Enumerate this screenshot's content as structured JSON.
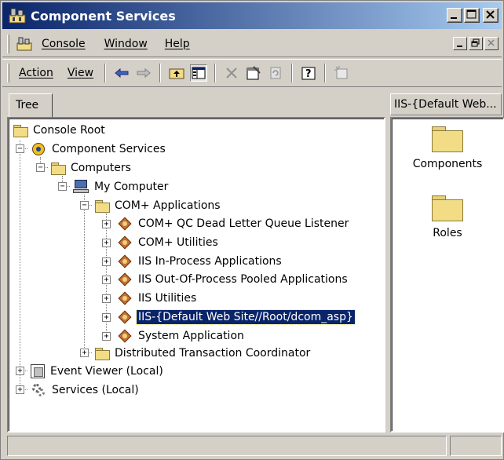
{
  "window": {
    "title": "Component Services"
  },
  "menubar": {
    "items": [
      "Console",
      "Window",
      "Help"
    ]
  },
  "toolbar": {
    "action_label": "Action",
    "view_label": "View"
  },
  "tabs": {
    "tree_label": "Tree",
    "right_header": "IIS-{Default Web..."
  },
  "tree": {
    "console_root": "Console Root",
    "component_services": "Component Services",
    "computers": "Computers",
    "my_computer": "My Computer",
    "com_apps": "COM+ Applications",
    "apps": [
      "COM+ QC Dead Letter Queue Listener",
      "COM+ Utilities",
      "IIS In-Process Applications",
      "IIS Out-Of-Process Pooled Applications",
      "IIS Utilities",
      "IIS-{Default Web Site//Root/dcom_asp}",
      "System Application"
    ],
    "selected_app": "IIS-{Default Web Site//Root/dcom_asp}",
    "dtc": "Distributed Transaction Coordinator",
    "event_viewer": "Event Viewer (Local)",
    "services": "Services (Local)"
  },
  "right_pane": {
    "items": [
      "Components",
      "Roles"
    ]
  },
  "colors": {
    "title_gradient_start": "#0a246a",
    "title_gradient_end": "#a6caf0",
    "selection": "#0a246a",
    "window_face": "#d4d0c8"
  }
}
